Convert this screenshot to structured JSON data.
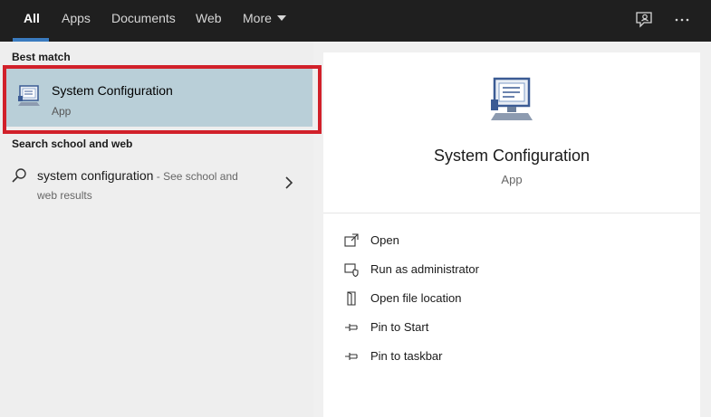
{
  "tabs": [
    {
      "label": "All",
      "active": true
    },
    {
      "label": "Apps"
    },
    {
      "label": "Documents"
    },
    {
      "label": "Web"
    },
    {
      "label": "More"
    }
  ],
  "top_icons": [
    "feedback-icon",
    "more-options-icon"
  ],
  "left": {
    "best_match_title": "Best match",
    "best_match": {
      "name": "System Configuration",
      "type": "App",
      "icon": "system-configuration-icon",
      "highlight_color": "#d1202a"
    },
    "search_web_title": "Search school and web",
    "web_result": {
      "query": "system configuration",
      "suffix": " - See school and",
      "suffix_line2": "web results",
      "icon": "search-icon"
    }
  },
  "right": {
    "app_name": "System Configuration",
    "app_type": "App",
    "actions": [
      {
        "label": "Open",
        "icon": "open-icon"
      },
      {
        "label": "Run as administrator",
        "icon": "shield-icon"
      },
      {
        "label": "Open file location",
        "icon": "folder-location-icon"
      },
      {
        "label": "Pin to Start",
        "icon": "pin-icon"
      },
      {
        "label": "Pin to taskbar",
        "icon": "pin-icon"
      }
    ]
  }
}
